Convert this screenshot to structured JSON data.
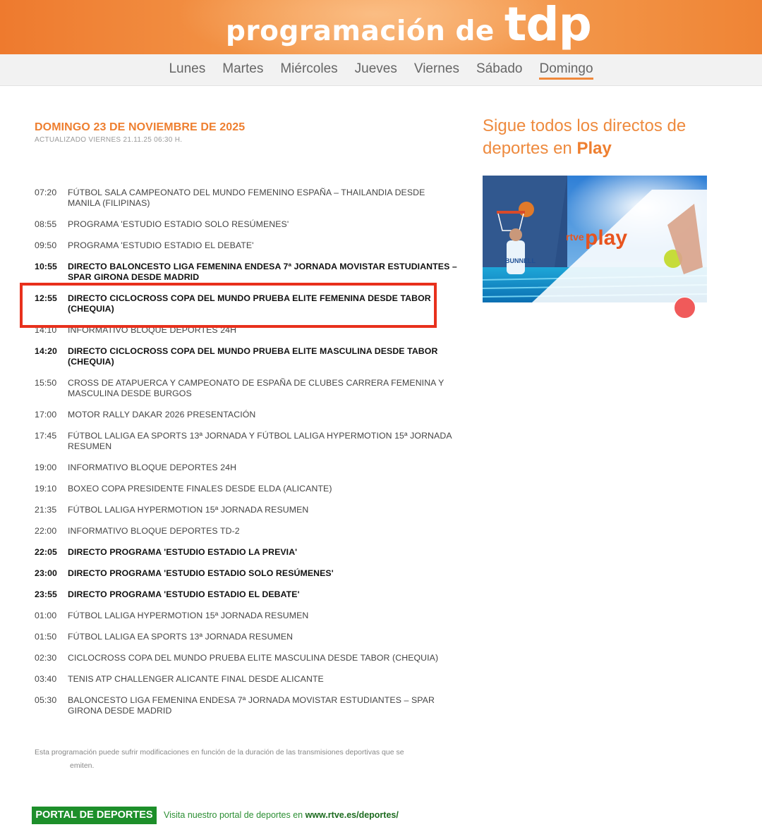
{
  "banner": {
    "title_text": "programación de",
    "brand": "tdp"
  },
  "nav": {
    "days": [
      "Lunes",
      "Martes",
      "Miércoles",
      "Jueves",
      "Viernes",
      "Sábado",
      "Domingo"
    ],
    "active": "Domingo"
  },
  "main": {
    "day_title": "DOMINGO 23 DE NOVIEMBRE DE 2025",
    "updated": "ACTUALIZADO VIERNES 21.11.25 06:30 H."
  },
  "schedule": [
    {
      "time": "07:20",
      "program": "FÚTBOL SALA CAMPEONATO DEL MUNDO FEMENINO ESPAÑA – THAILANDIA DESDE MANILA (FILIPINAS)",
      "live": false
    },
    {
      "time": "08:55",
      "program": "PROGRAMA 'ESTUDIO ESTADIO SOLO RESÚMENES'",
      "live": false
    },
    {
      "time": "09:50",
      "program": "PROGRAMA 'ESTUDIO ESTADIO EL DEBATE'",
      "live": false
    },
    {
      "time": "10:55",
      "program": "DIRECTO BALONCESTO LIGA FEMENINA ENDESA 7ª JORNADA MOVISTAR ESTUDIANTES – SPAR GIRONA DESDE MADRID",
      "live": true
    },
    {
      "time": "12:55",
      "program": "DIRECTO CICLOCROSS COPA DEL MUNDO PRUEBA ELITE FEMENINA DESDE TABOR (CHEQUIA)",
      "live": true
    },
    {
      "time": "14:10",
      "program": "INFORMATIVO BLOQUE DEPORTES 24H",
      "live": false
    },
    {
      "time": "14:20",
      "program": "DIRECTO CICLOCROSS COPA DEL MUNDO PRUEBA ELITE MASCULINA DESDE TABOR (CHEQUIA)",
      "live": true
    },
    {
      "time": "15:50",
      "program": "CROSS DE ATAPUERCA Y CAMPEONATO DE ESPAÑA DE CLUBES CARRERA FEMENINA Y MASCULINA DESDE BURGOS",
      "live": false
    },
    {
      "time": "17:00",
      "program": "MOTOR RALLY DAKAR 2026 PRESENTACIÓN",
      "live": false
    },
    {
      "time": "17:45",
      "program": "FÚTBOL LALIGA EA SPORTS 13ª JORNADA Y FÚTBOL LALIGA HYPERMOTION 15ª JORNADA RESUMEN",
      "live": false
    },
    {
      "time": "19:00",
      "program": "INFORMATIVO BLOQUE DEPORTES 24H",
      "live": false
    },
    {
      "time": "19:10",
      "program": "BOXEO COPA PRESIDENTE FINALES DESDE ELDA (ALICANTE)",
      "live": false
    },
    {
      "time": "21:35",
      "program": "FÚTBOL LALIGA HYPERMOTION 15ª JORNADA RESUMEN",
      "live": false
    },
    {
      "time": "22:00",
      "program": "INFORMATIVO BLOQUE DEPORTES TD-2",
      "live": false
    },
    {
      "time": "22:05",
      "program": "DIRECTO PROGRAMA 'ESTUDIO ESTADIO LA PREVIA'",
      "live": true
    },
    {
      "time": "23:00",
      "program": "DIRECTO PROGRAMA 'ESTUDIO ESTADIO SOLO RESÚMENES'",
      "live": true
    },
    {
      "time": "23:55",
      "program": "DIRECTO PROGRAMA 'ESTUDIO ESTADIO EL DEBATE'",
      "live": true
    },
    {
      "time": "01:00",
      "program": "FÚTBOL LALIGA HYPERMOTION 15ª JORNADA RESUMEN",
      "live": false
    },
    {
      "time": "01:50",
      "program": "FÚTBOL LALIGA EA SPORTS 13ª JORNADA RESUMEN",
      "live": false
    },
    {
      "time": "02:30",
      "program": "CICLOCROSS COPA DEL MUNDO PRUEBA ELITE MASCULINA DESDE TABOR (CHEQUIA)",
      "live": false
    },
    {
      "time": "03:40",
      "program": "TENIS ATP CHALLENGER ALICANTE FINAL DESDE ALICANTE",
      "live": false
    },
    {
      "time": "05:30",
      "program": "BALONCESTO LIGA FEMENINA ENDESA 7ª JORNADA MOVISTAR ESTUDIANTES – SPAR GIRONA DESDE MADRID",
      "live": false
    }
  ],
  "note": {
    "line1": "Esta programación puede sufrir modificaciones en función de la duración de las transmisiones deportivas que se",
    "line2": "emiten."
  },
  "footer": {
    "portal_button": "PORTAL DE DEPORTES",
    "portal_text": "Visita nuestro portal de deportes en",
    "portal_link": "www.rtve.es/deportes/"
  },
  "sidebar": {
    "title": "Sigue todos los directos de deportes en",
    "title_bold": "Play",
    "promo_logo_small": "rtve",
    "promo_logo_big": "play",
    "jersey_text": "BUNNELL"
  },
  "colors": {
    "accent": "#ee7f30",
    "highlight": "#e8301c",
    "portal_green": "#1d8f2a"
  }
}
